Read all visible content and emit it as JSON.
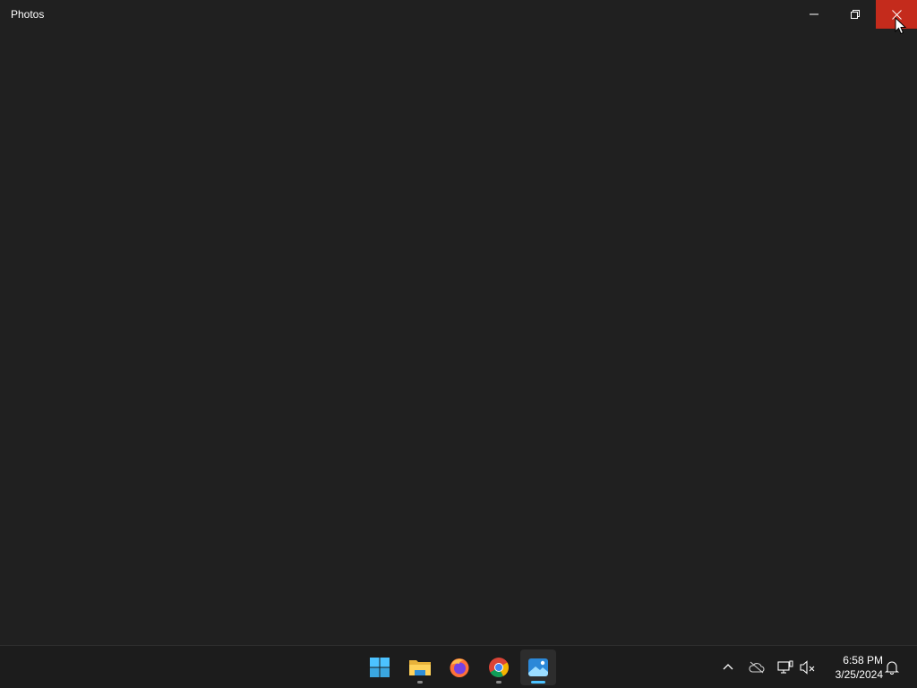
{
  "window": {
    "title": "Photos",
    "controls": {
      "minimize_icon": "minimize-icon",
      "maximize_icon": "restore-icon",
      "close_icon": "close-icon",
      "close_hover_color": "#c42b1c"
    }
  },
  "taskbar": {
    "apps": [
      {
        "name": "Start",
        "icon": "windows-start-icon",
        "running": false,
        "active": false
      },
      {
        "name": "File Explorer",
        "icon": "folder-icon",
        "running": true,
        "active": false
      },
      {
        "name": "Firefox",
        "icon": "firefox-icon",
        "running": false,
        "active": false
      },
      {
        "name": "Google Chrome",
        "icon": "chrome-icon",
        "running": true,
        "active": false
      },
      {
        "name": "Photos",
        "icon": "photos-icon",
        "running": true,
        "active": true
      }
    ],
    "tray": {
      "icons": [
        "chevron-up-icon",
        "onedrive-icon",
        "network-icon",
        "volume-muted-icon",
        "notification-bell-icon"
      ],
      "time": "6:58 PM",
      "date": "3/25/2024"
    }
  },
  "colors": {
    "background": "#202020",
    "taskbar": "#1c1c1c",
    "accent": "#4cc2ff"
  }
}
